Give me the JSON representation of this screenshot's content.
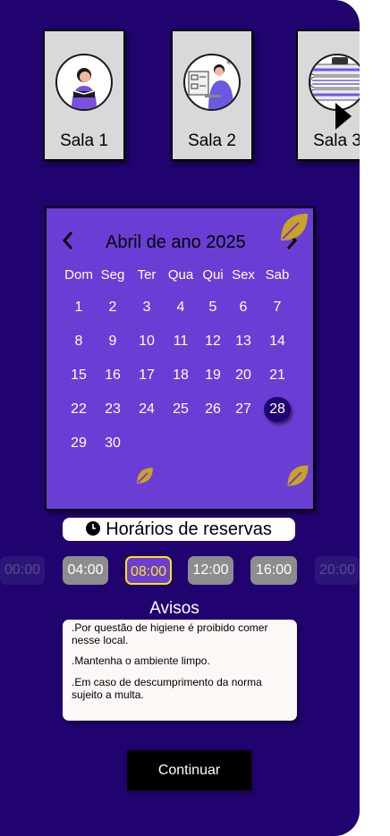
{
  "rooms": [
    {
      "label": "Sala 1",
      "icon": "person-reading-icon"
    },
    {
      "label": "Sala 2",
      "icon": "person-at-computer-icon"
    },
    {
      "label": "Sala 3",
      "icon": "books-icon"
    }
  ],
  "calendar": {
    "title": "Abril de ano 2025",
    "weekdays": [
      "Dom",
      "Seg",
      "Ter",
      "Qua",
      "Qui",
      "Sex",
      "Sab"
    ],
    "days": [
      "1",
      "2",
      "3",
      "4",
      "5",
      "6",
      "7",
      "8",
      "9",
      "10",
      "11",
      "12",
      "13",
      "14",
      "15",
      "16",
      "17",
      "18",
      "19",
      "20",
      "21",
      "22",
      "23",
      "24",
      "25",
      "26",
      "27",
      "28",
      "29",
      "30"
    ],
    "selected_day": "28",
    "prev_icon": "chevron-left-icon",
    "next_icon": "chevron-right-icon"
  },
  "schedule": {
    "title": "Horários de reservas",
    "times": [
      "00:00",
      "04:00",
      "08:00",
      "12:00",
      "16:00",
      "20:00"
    ],
    "selected_time": "08:00"
  },
  "notices": {
    "title": "Avisos",
    "items": [
      ".Por questão de higiene é proibido comer nesse local.",
      ".Mantenha o ambiente limpo.",
      ".Em caso de descumprimento da norma sujeito a multa."
    ]
  },
  "continue_label": "Continuar",
  "colors": {
    "background": "#21036f",
    "calendar": "#6a3ed5",
    "highlight": "#ffe600",
    "leaf": "#c9a227"
  }
}
